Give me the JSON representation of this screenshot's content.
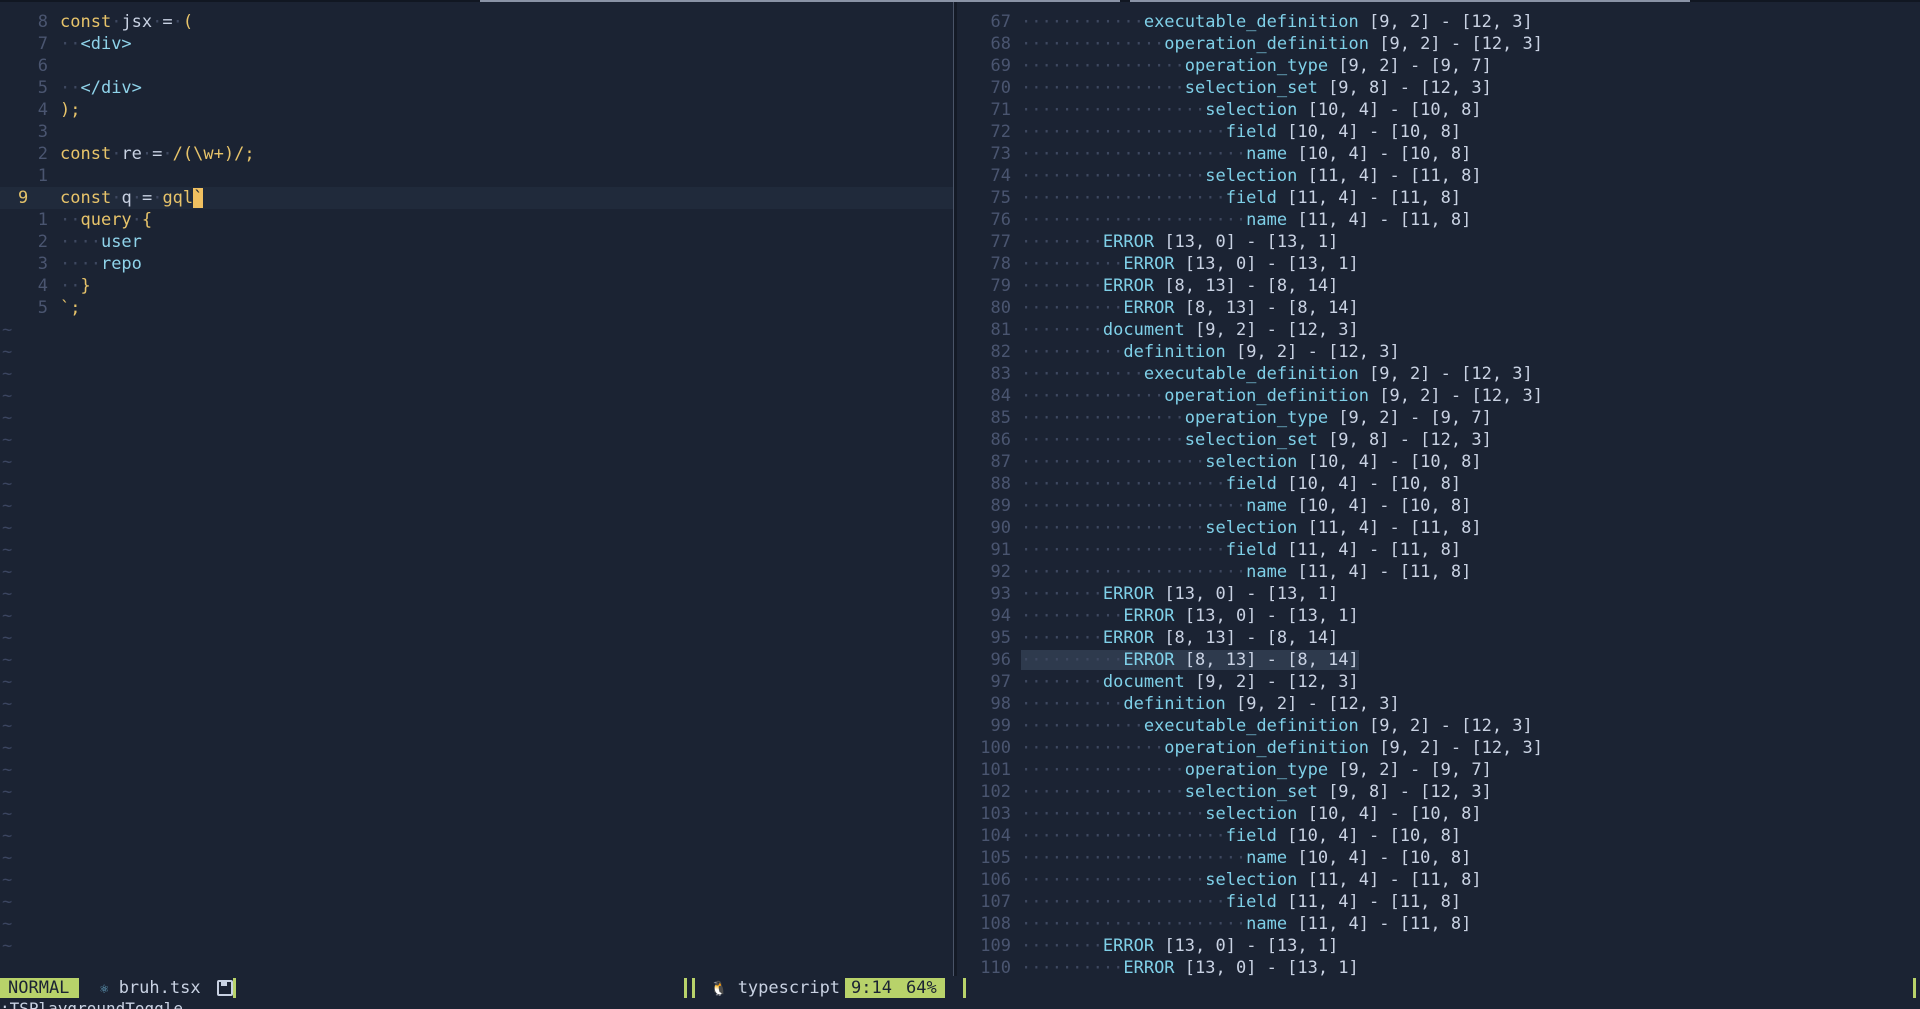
{
  "left_pane": {
    "lines": [
      {
        "num": "8",
        "segments": [
          [
            "kw",
            "const"
          ],
          [
            "dot",
            "·"
          ],
          [
            "punc",
            "jsx"
          ],
          [
            "dot",
            "·"
          ],
          [
            "punc",
            "="
          ],
          [
            "dot",
            "·"
          ],
          [
            "kw",
            "("
          ]
        ]
      },
      {
        "num": "7",
        "segments": [
          [
            "dot",
            "··"
          ],
          [
            "tag",
            "<div>"
          ]
        ]
      },
      {
        "num": "6",
        "segments": []
      },
      {
        "num": "5",
        "segments": [
          [
            "dot",
            "··"
          ],
          [
            "tag",
            "</div>"
          ]
        ]
      },
      {
        "num": "4",
        "segments": [
          [
            "kw",
            ");"
          ]
        ]
      },
      {
        "num": "3",
        "segments": []
      },
      {
        "num": "2",
        "segments": [
          [
            "kw",
            "const"
          ],
          [
            "dot",
            "·"
          ],
          [
            "punc",
            "re"
          ],
          [
            "dot",
            "·"
          ],
          [
            "punc",
            "="
          ],
          [
            "dot",
            "·"
          ],
          [
            "str",
            "/(\\w+)/;"
          ]
        ]
      },
      {
        "num": "1",
        "segments": []
      },
      {
        "num": "9",
        "current": true,
        "segments": [
          [
            "kw",
            "const"
          ],
          [
            "dot",
            "·"
          ],
          [
            "punc",
            "q"
          ],
          [
            "dot",
            "·"
          ],
          [
            "punc",
            "="
          ],
          [
            "dot",
            "·"
          ],
          [
            "gql",
            "gql"
          ],
          [
            "cursor",
            "`"
          ]
        ]
      },
      {
        "num": "1",
        "segments": [
          [
            "dot",
            "··"
          ],
          [
            "kw",
            "query"
          ],
          [
            "dot",
            "·"
          ],
          [
            "kw",
            "{"
          ]
        ]
      },
      {
        "num": "2",
        "segments": [
          [
            "dot",
            "····"
          ],
          [
            "q-field",
            "user"
          ]
        ]
      },
      {
        "num": "3",
        "segments": [
          [
            "dot",
            "····"
          ],
          [
            "q-field",
            "repo"
          ]
        ]
      },
      {
        "num": "4",
        "segments": [
          [
            "dot",
            "··"
          ],
          [
            "kw",
            "}"
          ]
        ]
      },
      {
        "num": "5",
        "segments": [
          [
            "kw",
            "`;"
          ]
        ]
      }
    ],
    "tilde_count": 29,
    "tilde_char": "~"
  },
  "right_pane": {
    "lines": [
      {
        "num": "67",
        "indent": 12,
        "text": "executable_definition [9, 2] - [12, 3]"
      },
      {
        "num": "68",
        "indent": 14,
        "text": "operation_definition [9, 2] - [12, 3]"
      },
      {
        "num": "69",
        "indent": 16,
        "text": "operation_type [9, 2] - [9, 7]"
      },
      {
        "num": "70",
        "indent": 16,
        "text": "selection_set [9, 8] - [12, 3]"
      },
      {
        "num": "71",
        "indent": 18,
        "text": "selection [10, 4] - [10, 8]"
      },
      {
        "num": "72",
        "indent": 20,
        "text": "field [10, 4] - [10, 8]"
      },
      {
        "num": "73",
        "indent": 22,
        "text": "name [10, 4] - [10, 8]"
      },
      {
        "num": "74",
        "indent": 18,
        "text": "selection [11, 4] - [11, 8]"
      },
      {
        "num": "75",
        "indent": 20,
        "text": "field [11, 4] - [11, 8]"
      },
      {
        "num": "76",
        "indent": 22,
        "text": "name [11, 4] - [11, 8]"
      },
      {
        "num": "77",
        "indent": 8,
        "text": "ERROR [13, 0] - [13, 1]"
      },
      {
        "num": "78",
        "indent": 10,
        "text": "ERROR [13, 0] - [13, 1]"
      },
      {
        "num": "79",
        "indent": 8,
        "text": "ERROR [8, 13] - [8, 14]"
      },
      {
        "num": "80",
        "indent": 10,
        "text": "ERROR [8, 13] - [8, 14]"
      },
      {
        "num": "81",
        "indent": 8,
        "text": "document [9, 2] - [12, 3]"
      },
      {
        "num": "82",
        "indent": 10,
        "text": "definition [9, 2] - [12, 3]"
      },
      {
        "num": "83",
        "indent": 12,
        "text": "executable_definition [9, 2] - [12, 3]"
      },
      {
        "num": "84",
        "indent": 14,
        "text": "operation_definition [9, 2] - [12, 3]"
      },
      {
        "num": "85",
        "indent": 16,
        "text": "operation_type [9, 2] - [9, 7]"
      },
      {
        "num": "86",
        "indent": 16,
        "text": "selection_set [9, 8] - [12, 3]"
      },
      {
        "num": "87",
        "indent": 18,
        "text": "selection [10, 4] - [10, 8]"
      },
      {
        "num": "88",
        "indent": 20,
        "text": "field [10, 4] - [10, 8]"
      },
      {
        "num": "89",
        "indent": 22,
        "text": "name [10, 4] - [10, 8]"
      },
      {
        "num": "90",
        "indent": 18,
        "text": "selection [11, 4] - [11, 8]"
      },
      {
        "num": "91",
        "indent": 20,
        "text": "field [11, 4] - [11, 8]"
      },
      {
        "num": "92",
        "indent": 22,
        "text": "name [11, 4] - [11, 8]"
      },
      {
        "num": "93",
        "indent": 8,
        "text": "ERROR [13, 0] - [13, 1]"
      },
      {
        "num": "94",
        "indent": 10,
        "text": "ERROR [13, 0] - [13, 1]"
      },
      {
        "num": "95",
        "indent": 8,
        "text": "ERROR [8, 13] - [8, 14]"
      },
      {
        "num": "96",
        "indent": 10,
        "text": "ERROR [8, 13] - [8, 14]",
        "highlight": true
      },
      {
        "num": "97",
        "indent": 8,
        "text": "document [9, 2] - [12, 3]"
      },
      {
        "num": "98",
        "indent": 10,
        "text": "definition [9, 2] - [12, 3]"
      },
      {
        "num": "99",
        "indent": 12,
        "text": "executable_definition [9, 2] - [12, 3]"
      },
      {
        "num": "100",
        "indent": 14,
        "text": "operation_definition [9, 2] - [12, 3]"
      },
      {
        "num": "101",
        "indent": 16,
        "text": "operation_type [9, 2] - [9, 7]"
      },
      {
        "num": "102",
        "indent": 16,
        "text": "selection_set [9, 8] - [12, 3]"
      },
      {
        "num": "103",
        "indent": 18,
        "text": "selection [10, 4] - [10, 8]"
      },
      {
        "num": "104",
        "indent": 20,
        "text": "field [10, 4] - [10, 8]"
      },
      {
        "num": "105",
        "indent": 22,
        "text": "name [10, 4] - [10, 8]"
      },
      {
        "num": "106",
        "indent": 18,
        "text": "selection [11, 4] - [11, 8]"
      },
      {
        "num": "107",
        "indent": 20,
        "text": "field [11, 4] - [11, 8]"
      },
      {
        "num": "108",
        "indent": 22,
        "text": "name [11, 4] - [11, 8]"
      },
      {
        "num": "109",
        "indent": 8,
        "text": "ERROR [13, 0] - [13, 1]"
      },
      {
        "num": "110",
        "indent": 10,
        "text": "ERROR [13, 0] - [13, 1]"
      }
    ]
  },
  "statusline": {
    "mode": "NORMAL",
    "file_icon": "react-icon",
    "filename": "bruh.tsx",
    "save_icon": "save-icon",
    "filetype_icon": "linux-icon",
    "filetype": "typescript",
    "position": "9:14",
    "percent": "64%"
  },
  "cmdline": ":TSPlaygroundToggle",
  "colors": {
    "background": "#1b2333",
    "accent": "#b8d26a",
    "keyword": "#e8c46a",
    "node": "#7fd0e8"
  }
}
